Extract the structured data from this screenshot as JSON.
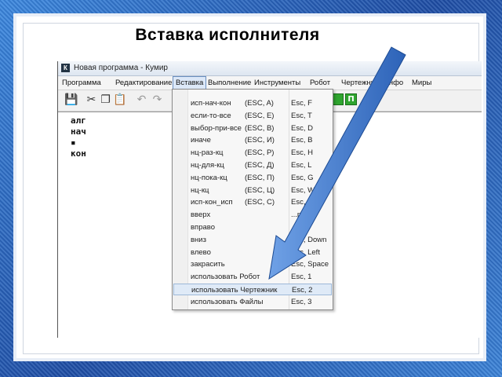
{
  "slide": {
    "title": "Вставка  исполнителя"
  },
  "window": {
    "title": "Новая программа - Кумир",
    "icon_letter": "К"
  },
  "menu": [
    {
      "label": "Программа",
      "active": false
    },
    {
      "label": "Редактирование",
      "active": false
    },
    {
      "label": "Вставка",
      "active": true
    },
    {
      "label": "Выполнение",
      "active": false
    },
    {
      "label": "Инструменты",
      "active": false
    },
    {
      "label": "Робот",
      "active": false
    },
    {
      "label": "Чертежник",
      "active": false
    },
    {
      "label": "Инфо",
      "active": false
    },
    {
      "label": "Миры",
      "active": false
    }
  ],
  "toolbar_icons": [
    "save-icon",
    "cut-icon",
    "copy-icon",
    "paste-icon",
    "undo-icon",
    "redo-icon"
  ],
  "toolbar_right": [
    "П"
  ],
  "code_lines": [
    "алг",
    "нач",
    "▪",
    "кон"
  ],
  "dropdown": [
    {
      "label": "исп-нач-кон",
      "esc": "(ESC, A)",
      "key": "Esc, F"
    },
    {
      "label": "если-то-все",
      "esc": "(ESC, E)",
      "key": "Esc, T"
    },
    {
      "label": "выбор-при-все",
      "esc": "(ESC, B)",
      "key": "Esc, D"
    },
    {
      "label": "иначе",
      "esc": "(ESC, И)",
      "key": "Esc, B"
    },
    {
      "label": "нц-раз-кц",
      "esc": "(ESC, P)",
      "key": "Esc, H"
    },
    {
      "label": "нц-для-кц",
      "esc": "(ESC, Д)",
      "key": "Esc, L"
    },
    {
      "label": "нц-пока-кц",
      "esc": "(ESC, П)",
      "key": "Esc, G"
    },
    {
      "label": "нц-кц",
      "esc": "(ESC, Ц)",
      "key": "Esc, W"
    },
    {
      "label": "исп-кон_исп",
      "esc": "(ESC, C)",
      "key": "Esc, ..."
    },
    {
      "label": "вверх",
      "esc": "",
      "key": "...p"
    },
    {
      "label": "вправо",
      "esc": "",
      "key": "...ight"
    },
    {
      "label": "вниз",
      "esc": "",
      "key": "Esc, Down"
    },
    {
      "label": "влево",
      "esc": "",
      "key": "Esc, Left"
    },
    {
      "label": "закрасить",
      "esc": "",
      "key": "Esc, Space"
    },
    {
      "label": "использовать Робот",
      "esc": "",
      "key": "Esc, 1"
    },
    {
      "label": "использовать Чертежник",
      "esc": "",
      "key": "Esc, 2",
      "highlighted": true
    },
    {
      "label": "использовать Файлы",
      "esc": "",
      "key": "Esc, 3"
    }
  ],
  "colors": {
    "frame": "#2f6fc0",
    "arrow": "#4a7fd0",
    "highlight": "#dfeaf7"
  }
}
